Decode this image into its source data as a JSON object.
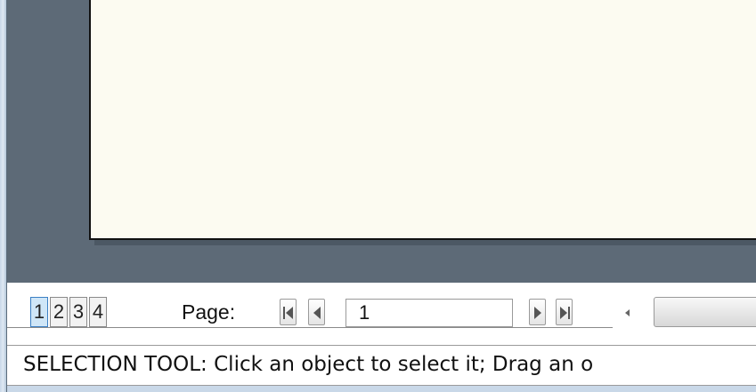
{
  "page_tabs": [
    "1",
    "2",
    "3",
    "4"
  ],
  "active_tab": "1",
  "navigation": {
    "page_label": "Page:",
    "page_value": "1",
    "first_icon": "first-page-icon",
    "prev_icon": "previous-page-icon",
    "next_icon": "next-page-icon",
    "last_icon": "last-page-icon",
    "scroll_left_icon": "scroll-left-icon"
  },
  "status_bar": {
    "text": "SELECTION TOOL: Click an object to select it; Drag an o"
  },
  "colors": {
    "canvas_background": "#5d6a77",
    "page_background": "#fcfbf1",
    "active_tab": "#cfe6f7"
  }
}
